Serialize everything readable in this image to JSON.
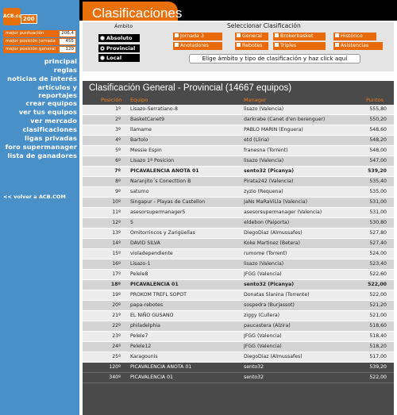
{
  "logo": {
    "badge": "ACB.com",
    "num": "200"
  },
  "stats": [
    {
      "label": "mejor puntuación",
      "value": "206,4"
    },
    {
      "label": "mejor posición jornada",
      "value": "455"
    },
    {
      "label": "mejor posición general",
      "value": "120"
    }
  ],
  "menu": [
    {
      "label": "principal"
    },
    {
      "label": "reglas"
    },
    {
      "label": "noticias de interés"
    },
    {
      "label": "artículos y reportajes"
    },
    {
      "label": "crear equipos"
    },
    {
      "label": "ver tus equipos"
    },
    {
      "label": "ver mercado"
    },
    {
      "label": "clasificaciones"
    },
    {
      "label": "ligas privadas"
    },
    {
      "label": "foro supermanager"
    },
    {
      "label": "lista de ganadores"
    }
  ],
  "back_link": "<< volver a ACB.COM",
  "header": {
    "title": "Clasificaciones"
  },
  "filters": {
    "ambito_title": "Ámbito",
    "ambito": [
      {
        "label": "Absoluto",
        "selected": false
      },
      {
        "label": "Provincial",
        "selected": true
      },
      {
        "label": "Local",
        "selected": false
      }
    ],
    "clasif_title": "Seleccionar Clasificación",
    "clasificaciones": [
      {
        "label": "Jornada 3"
      },
      {
        "label": "General"
      },
      {
        "label": "Brokerbasket"
      },
      {
        "label": "Histórico"
      },
      {
        "label": "Anotadores"
      },
      {
        "label": "Rebotes"
      },
      {
        "label": "Triples"
      },
      {
        "label": "Asistencias"
      }
    ],
    "instruction": "Elige ámbito y tipo de clasificación y haz click aquí"
  },
  "results": {
    "title": "Clasificación General - Provincial (14667 equipos)",
    "columns": {
      "pos": "Posición",
      "team": "Equipo",
      "manager": "Manager",
      "pts": "Puntos"
    },
    "rows": [
      {
        "pos": "1º",
        "team": "Lisazo-Serratiano-8",
        "manager": "lisazo (Valencia)",
        "pts": "555,80"
      },
      {
        "pos": "2º",
        "team": "BasketCanet9",
        "manager": "darkrabe (Canet d'en berenguer)",
        "pts": "550,20"
      },
      {
        "pos": "3º",
        "team": "llamame",
        "manager": "PABLO MARIN (Enguera)",
        "pts": "548,60"
      },
      {
        "pos": "4º",
        "team": "Bartolo",
        "manager": "etd (Lliria)",
        "pts": "548,20"
      },
      {
        "pos": "5º",
        "team": "Messie Espin",
        "manager": "franesna (Torrent)",
        "pts": "548,00"
      },
      {
        "pos": "6º",
        "team": "Lisazo 1ª Posicion",
        "manager": "lisazo (Valencia)",
        "pts": "547,00"
      },
      {
        "pos": "7º",
        "team": "PICAVALENCIA ANOTA 01",
        "manager": "sento32 (Picanya)",
        "pts": "539,20",
        "bold": true
      },
      {
        "pos": "8º",
        "team": "Naranjito´s Conecttion B",
        "manager": "Pirata242 (Valencia)",
        "pts": "535,40"
      },
      {
        "pos": "9º",
        "team": "saturno",
        "manager": "zyzio (Requena)",
        "pts": "535,00"
      },
      {
        "pos": "10º",
        "team": "Singapur - Playas de Castellon",
        "manager": "JaNs MaRaViLla (Valencia)",
        "pts": "531,00"
      },
      {
        "pos": "11º",
        "team": "asesorsupermanager5",
        "manager": "asesorsupermanager (Valencia)",
        "pts": "531,00"
      },
      {
        "pos": "12º",
        "team": "5",
        "manager": "eldebon (Paiporta)",
        "pts": "530,80"
      },
      {
        "pos": "13º",
        "team": "Omitorrincos y Zarigüellas",
        "manager": "DiegoDiaz (Almussafes)",
        "pts": "527,80"
      },
      {
        "pos": "14º",
        "team": "DAVID SILVA",
        "manager": "Koke Martinez (Betera)",
        "pts": "527,40"
      },
      {
        "pos": "15º",
        "team": "violadependiente",
        "manager": "rumome (Torrent)",
        "pts": "524,00"
      },
      {
        "pos": "16º",
        "team": "Lisazo-1",
        "manager": "lisazo (Valencia)",
        "pts": "523,40"
      },
      {
        "pos": "17º",
        "team": "Pelele8",
        "manager": "JFGG (Valencia)",
        "pts": "522,60"
      },
      {
        "pos": "18º",
        "team": "PICAVALENCIA 01",
        "manager": "sento32 (Picanya)",
        "pts": "522,00",
        "bold": true
      },
      {
        "pos": "19º",
        "team": "PROKOM TREFL SOPOT",
        "manager": "Donatas Slanina (Torrente)",
        "pts": "522,00"
      },
      {
        "pos": "20º",
        "team": "papa-rebotes",
        "manager": "sospedra (Burjassot)",
        "pts": "521,20"
      },
      {
        "pos": "21º",
        "team": "EL NIÑO GUSANO",
        "manager": "ziggy (Cullera)",
        "pts": "521,00"
      },
      {
        "pos": "22º",
        "team": "philadelphia",
        "manager": "paucastera (Alzira)",
        "pts": "518,60"
      },
      {
        "pos": "23º",
        "team": "Pelele7",
        "manager": "JFGG (Valencia)",
        "pts": "518,40"
      },
      {
        "pos": "24º",
        "team": "Pelele12",
        "manager": "JFGG (Valencia)",
        "pts": "518,20"
      },
      {
        "pos": "25º",
        "team": "Karagounis",
        "manager": "DiegoDiaz (Almussafes)",
        "pts": "517,00"
      }
    ],
    "extra_rows": [
      {
        "pos": "120º",
        "team": "PICAVALENCIA ANOTA 01",
        "manager": "sento32",
        "pts": "539,20"
      },
      {
        "pos": "340º",
        "team": "PICAVALENCIA 01",
        "manager": "sento32",
        "pts": "522,00"
      }
    ]
  }
}
